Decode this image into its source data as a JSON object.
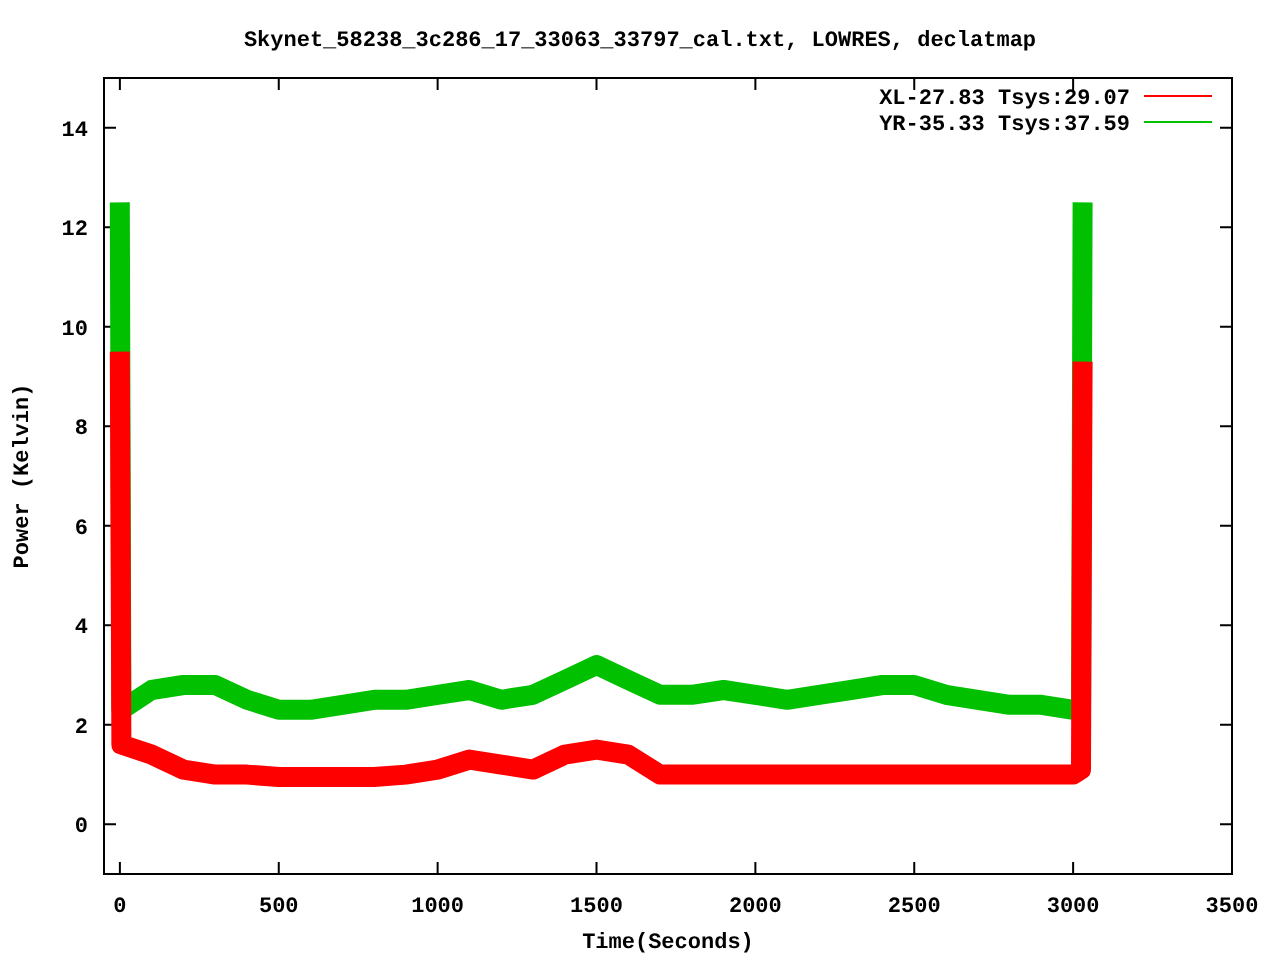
{
  "plot": {
    "chart_data": {
      "type": "line",
      "title": "Skynet_58238_3c286_17_33063_33797_cal.txt, LOWRES, declatmap",
      "xlabel": "Time(Seconds)",
      "ylabel": "Power (Kelvin)",
      "x": [
        0,
        5,
        100,
        200,
        300,
        400,
        500,
        600,
        700,
        800,
        900,
        1000,
        1100,
        1200,
        1300,
        1400,
        1500,
        1600,
        1700,
        1800,
        1900,
        2000,
        2100,
        2200,
        2300,
        2400,
        2500,
        2600,
        2700,
        2800,
        2900,
        3000,
        3025,
        3030
      ],
      "series": [
        {
          "name": "XL-27.83 Tsys:29.07",
          "color": "#ff0000",
          "values": [
            9.5,
            1.6,
            1.4,
            1.1,
            1.0,
            1.0,
            0.95,
            0.95,
            0.95,
            0.95,
            1.0,
            1.1,
            1.3,
            1.2,
            1.1,
            1.4,
            1.5,
            1.4,
            1.0,
            1.0,
            1.0,
            1.0,
            1.0,
            1.0,
            1.0,
            1.0,
            1.0,
            1.0,
            1.0,
            1.0,
            1.0,
            1.0,
            1.1,
            9.3
          ]
        },
        {
          "name": "YR-35.33 Tsys:37.59",
          "color": "#00c000",
          "values": [
            12.5,
            2.3,
            2.7,
            2.8,
            2.8,
            2.5,
            2.3,
            2.3,
            2.4,
            2.5,
            2.5,
            2.6,
            2.7,
            2.5,
            2.6,
            2.9,
            3.2,
            2.9,
            2.6,
            2.6,
            2.7,
            2.6,
            2.5,
            2.6,
            2.7,
            2.8,
            2.8,
            2.6,
            2.5,
            2.4,
            2.4,
            2.3,
            2.3,
            12.5
          ]
        }
      ],
      "legend": "top right",
      "xlim": [
        -50,
        3500
      ],
      "ylim": [
        -1,
        15
      ],
      "xticks": [
        0,
        500,
        1000,
        1500,
        2000,
        2500,
        3000,
        3500
      ],
      "yticks": [
        0,
        2,
        4,
        6,
        8,
        10,
        12,
        14
      ]
    }
  }
}
